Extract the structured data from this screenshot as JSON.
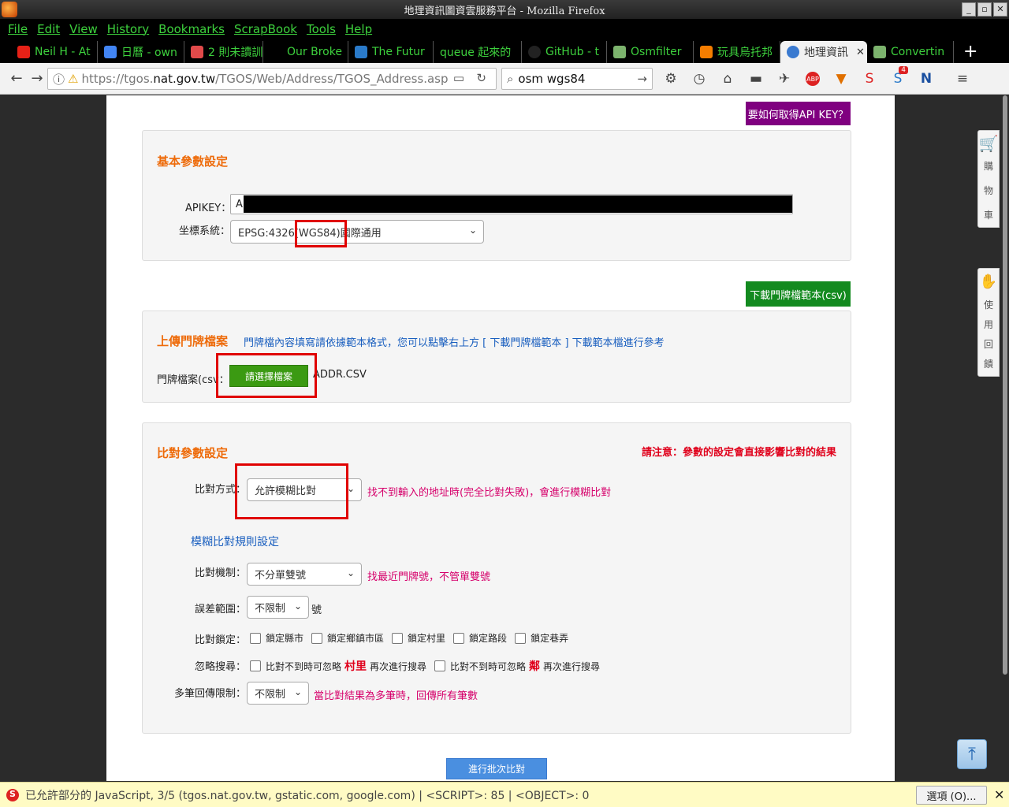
{
  "window": {
    "title": "地理資訊圖資雲服務平台 - Mozilla Firefox",
    "buttons": [
      "_",
      "▫",
      "✕"
    ]
  },
  "menu": [
    "File",
    "Edit",
    "View",
    "History",
    "Bookmarks",
    "ScrapBook",
    "Tools",
    "Help"
  ],
  "tabs": [
    {
      "label": "Neil H - At",
      "favicon_color": "#e62117"
    },
    {
      "label": "日曆 - own",
      "favicon_color": "#4285f4"
    },
    {
      "label": "2 則未讀訓",
      "favicon_color": "#e14a4a"
    },
    {
      "label": "Our Broke",
      "favicon_color": "#000000"
    },
    {
      "label": "The Futur",
      "favicon_color": "#2a7ac9"
    },
    {
      "label": "queue 起來的",
      "favicon_color": "#000000"
    },
    {
      "label": "GitHub - t",
      "favicon_color": "#222222"
    },
    {
      "label": "Osmfilter",
      "favicon_color": "#7cb36d"
    },
    {
      "label": "玩具烏托邦",
      "favicon_color": "#f57d00"
    },
    {
      "label": "地理資訊",
      "favicon_color": "#3a7ad0",
      "active": true
    },
    {
      "label": "Convertin",
      "favicon_color": "#7cb36d"
    }
  ],
  "new_tab": "+",
  "nav": {
    "url_prefix": "https://tgos.",
    "url_domain": "nat.gov.tw",
    "url_path": "/TGOS/Web/Address/TGOS_Address.asp",
    "search_value": "osm wgs84"
  },
  "toolbar_badge": "4",
  "page": {
    "api_key_button": "要如何取得API KEY？",
    "basic": {
      "title": "基本參數設定",
      "apikey_label": "APIKEY：",
      "apikey_value": "A",
      "crs_label": "坐標系統：",
      "crs_value": "EPSG:4326(WGS84)國際通用"
    },
    "download_button": "下載門牌檔範本(csv)",
    "upload": {
      "title": "上傳門牌檔案",
      "note": "門牌檔內容填寫請依據範本格式，您可以點擊右上方 [ 下載門牌檔範本 ] 下載範本檔進行參考",
      "file_label": "門牌檔案(csv",
      "file_colon": "：",
      "file_button": "請選擇檔案",
      "file_name": "ADDR.CSV"
    },
    "match": {
      "title": "比對參數設定",
      "warning": "請注意：參數的設定會直接影響比對的結果",
      "mode_label": "比對方式：",
      "mode_value": "允許模糊比對",
      "mode_note": "找不到輸入的地址時(完全比對失敗)，會進行模糊比對",
      "fuzzy_title": "模糊比對規則設定",
      "mechanism_label": "比對機制：",
      "mechanism_value": "不分單雙號",
      "mechanism_note": "找最近門牌號，不管單雙號",
      "range_label": "誤差範圍：",
      "range_value": "不限制",
      "range_unit": "號",
      "lock_label": "比對鎖定：",
      "lock_options": [
        "鎖定縣市",
        "鎖定鄉鎮市區",
        "鎖定村里",
        "鎖定路段",
        "鎖定巷弄"
      ],
      "ignore_label": "忽略搜尋：",
      "ignore_1_pre": "比對不到時可忽略",
      "ignore_1_key": "村里",
      "ignore_1_post": "再次進行搜尋",
      "ignore_2_pre": "比對不到時可忽略",
      "ignore_2_key": "鄰",
      "ignore_2_post": "再次進行搜尋",
      "multi_label": "多筆回傳限制：",
      "multi_value": "不限制",
      "multi_note": "當比對結果為多筆時，回傳所有筆數"
    },
    "submit_button": "進行批次比對"
  },
  "side": {
    "cart": [
      "購",
      "物",
      "車"
    ],
    "feedback": [
      "使",
      "用",
      "回",
      "饋"
    ]
  },
  "notification": {
    "text": "已允許部分的 JavaScript, 3/5 (tgos.nat.gov.tw, gstatic.com, google.com) | <SCRIPT>: 85 | <OBJECT>: 0",
    "options_button": "選項 (O)...",
    "close": "✕"
  },
  "colors": {
    "section_title": "#ee6b0a",
    "highlight_box": "#e00000",
    "api_button": "#800080",
    "green_button": "#138a1f",
    "link_blue": "#1a5fbf",
    "note_pink": "#d6006b",
    "warning_red": "#e0001b"
  }
}
